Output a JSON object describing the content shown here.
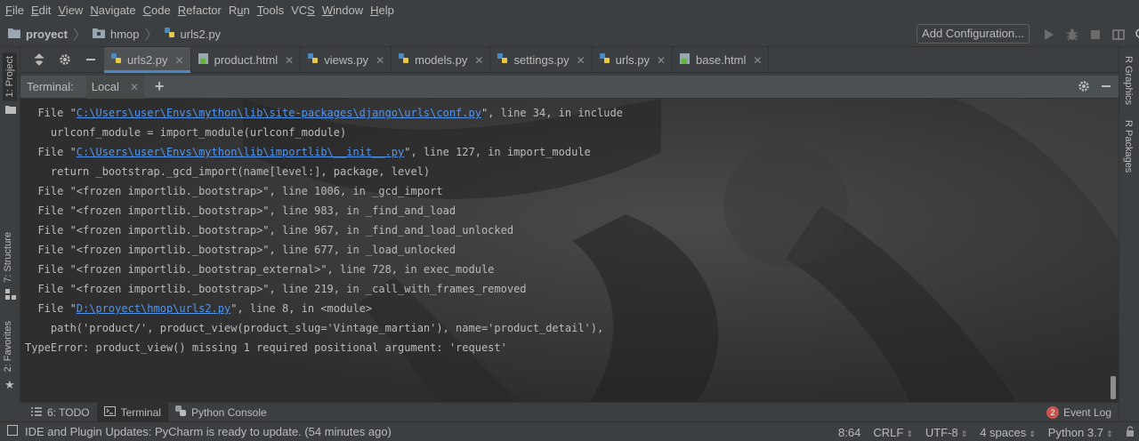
{
  "menu": [
    "File",
    "Edit",
    "View",
    "Navigate",
    "Code",
    "Refactor",
    "Run",
    "Tools",
    "VCS",
    "Window",
    "Help"
  ],
  "menu_mnemonic": [
    "F",
    "E",
    "V",
    "N",
    "C",
    "R",
    "u",
    "T",
    "S",
    "W",
    "H"
  ],
  "breadcrumbs": {
    "project": "proyect",
    "folder": "hmop",
    "file": "urls2.py"
  },
  "run_config": {
    "label": "Add Configuration..."
  },
  "left_stripe": {
    "project": "1: Project",
    "structure": "7: Structure",
    "favorites": "2: Favorites"
  },
  "right_stripe": {
    "graphics": "R Graphics",
    "packages": "R Packages"
  },
  "tabs": [
    {
      "label": "urls2.py",
      "type": "py",
      "active": true
    },
    {
      "label": "product.html",
      "type": "html",
      "active": false
    },
    {
      "label": "views.py",
      "type": "py",
      "active": false
    },
    {
      "label": "models.py",
      "type": "py",
      "active": false
    },
    {
      "label": "settings.py",
      "type": "py",
      "active": false
    },
    {
      "label": "urls.py",
      "type": "py",
      "active": false
    },
    {
      "label": "base.html",
      "type": "html",
      "active": false
    }
  ],
  "terminal": {
    "title": "Terminal:",
    "session_tab": "Local",
    "lines": [
      {
        "pre": "  File \"",
        "link": "C:\\Users\\user\\Envs\\mython\\lib\\site-packages\\django\\urls\\conf.py",
        "post": "\", line 34, in include"
      },
      {
        "pre": "    urlconf_module = import_module(urlconf_module)",
        "link": "",
        "post": ""
      },
      {
        "pre": "  File \"",
        "link": "C:\\Users\\user\\Envs\\mython\\lib\\importlib\\__init__.py",
        "post": "\", line 127, in import_module"
      },
      {
        "pre": "    return _bootstrap._gcd_import(name[level:], package, level)",
        "link": "",
        "post": ""
      },
      {
        "pre": "  File \"<frozen importlib._bootstrap>\", line 1006, in _gcd_import",
        "link": "",
        "post": ""
      },
      {
        "pre": "  File \"<frozen importlib._bootstrap>\", line 983, in _find_and_load",
        "link": "",
        "post": ""
      },
      {
        "pre": "  File \"<frozen importlib._bootstrap>\", line 967, in _find_and_load_unlocked",
        "link": "",
        "post": ""
      },
      {
        "pre": "  File \"<frozen importlib._bootstrap>\", line 677, in _load_unlocked",
        "link": "",
        "post": ""
      },
      {
        "pre": "  File \"<frozen importlib._bootstrap_external>\", line 728, in exec_module",
        "link": "",
        "post": ""
      },
      {
        "pre": "  File \"<frozen importlib._bootstrap>\", line 219, in _call_with_frames_removed",
        "link": "",
        "post": ""
      },
      {
        "pre": "  File \"",
        "link": "D:\\proyect\\hmop\\urls2.py",
        "post": "\", line 8, in <module>"
      },
      {
        "pre": "    path('product/', product_view(product_slug='Vintage_martian'), name='product_detail'),",
        "link": "",
        "post": ""
      },
      {
        "pre": "TypeError: product_view() missing 1 required positional argument: 'request'",
        "link": "",
        "post": ""
      }
    ]
  },
  "bottom_tools": {
    "todo": "6: TODO",
    "terminal": "Terminal",
    "python_console": "Python Console",
    "event_log": "Event Log",
    "event_count": "2"
  },
  "status": {
    "message": "IDE and Plugin Updates: PyCharm is ready to update. (54 minutes ago)",
    "position": "8:64",
    "line_sep": "CRLF",
    "encoding": "UTF-8",
    "indent": "4 spaces",
    "interpreter": "Python 3.7"
  },
  "colors": {
    "link": "#5394ec",
    "active_tab_underline": "#4a88c7",
    "badge": "#c75450"
  }
}
